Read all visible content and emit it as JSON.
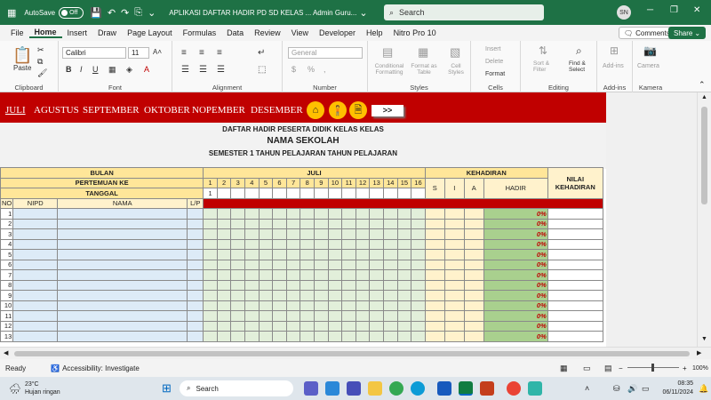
{
  "titlebar": {
    "autosave_label": "AutoSave",
    "autosave_state": "Off",
    "doc_title": "APLIKASI DAFTAR HADIR PD SD KELAS ... Admin Guru...",
    "search_placeholder": "Search",
    "user_initials": "SN"
  },
  "menu": {
    "items": [
      "File",
      "Home",
      "Insert",
      "Draw",
      "Page Layout",
      "Formulas",
      "Data",
      "Review",
      "View",
      "Developer",
      "Help",
      "Nitro Pro 10"
    ],
    "comments": "Comments",
    "share": "Share"
  },
  "ribbon": {
    "paste": "Paste",
    "clipboard": "Clipboard",
    "font_name": "Calibri",
    "font_size": "11",
    "font": "Font",
    "alignment": "Alignment",
    "number_format": "General",
    "number": "Number",
    "cond_format": "Conditional Formatting",
    "format_table": "Format as Table",
    "cell_styles": "Cell Styles",
    "styles": "Styles",
    "insert": "Insert",
    "delete": "Delete",
    "format": "Format",
    "cells": "Cells",
    "sort_filter": "Sort & Filter",
    "find_select": "Find & Select",
    "editing": "Editing",
    "addins": "Add-ins",
    "addins_group": "Add-ins",
    "camera": "Camera",
    "kamera": "Kamera"
  },
  "sheet": {
    "months": [
      "JULI",
      "AGUSTUS",
      "SEPTEMBER",
      "OKTOBER",
      "NOPEMBER",
      "DESEMBER"
    ],
    "next": ">>",
    "heading1": "DAFTAR HADIR PESERTA DIDIK KELAS KELAS",
    "heading2": "NAMA SEKOLAH",
    "heading3": "SEMESTER 1 TAHUN PELAJARAN TAHUN PELAJARAN",
    "bulan": "BULAN",
    "pertemuan": "PERTEMUAN KE",
    "tanggal": "TANGGAL",
    "month_value": "JULI",
    "kehadiran": "KEHADIRAN",
    "nilai1": "NILAI",
    "nilai2": "KEHADIRAN",
    "s": "S",
    "i": "I",
    "a": "A",
    "hadir": "HADIR",
    "first_date": "1",
    "col_no": "NO",
    "col_nipd": "NIPD",
    "col_nama": "NAMA",
    "col_lp": "L/P",
    "meetings": [
      "1",
      "2",
      "3",
      "4",
      "5",
      "6",
      "7",
      "8",
      "9",
      "10",
      "11",
      "12",
      "13",
      "14",
      "15",
      "16"
    ],
    "rows": [
      "1",
      "2",
      "3",
      "4",
      "5",
      "6",
      "7",
      "8",
      "9",
      "10",
      "11",
      "12",
      "13"
    ],
    "pct": "0%"
  },
  "status": {
    "ready": "Ready",
    "accessibility": "Accessibility: Investigate",
    "zoom": "100%"
  },
  "taskbar": {
    "temp": "23°C",
    "weather": "Hujan ringan",
    "search": "Search",
    "time": "08:35",
    "date": "06/11/2024"
  }
}
